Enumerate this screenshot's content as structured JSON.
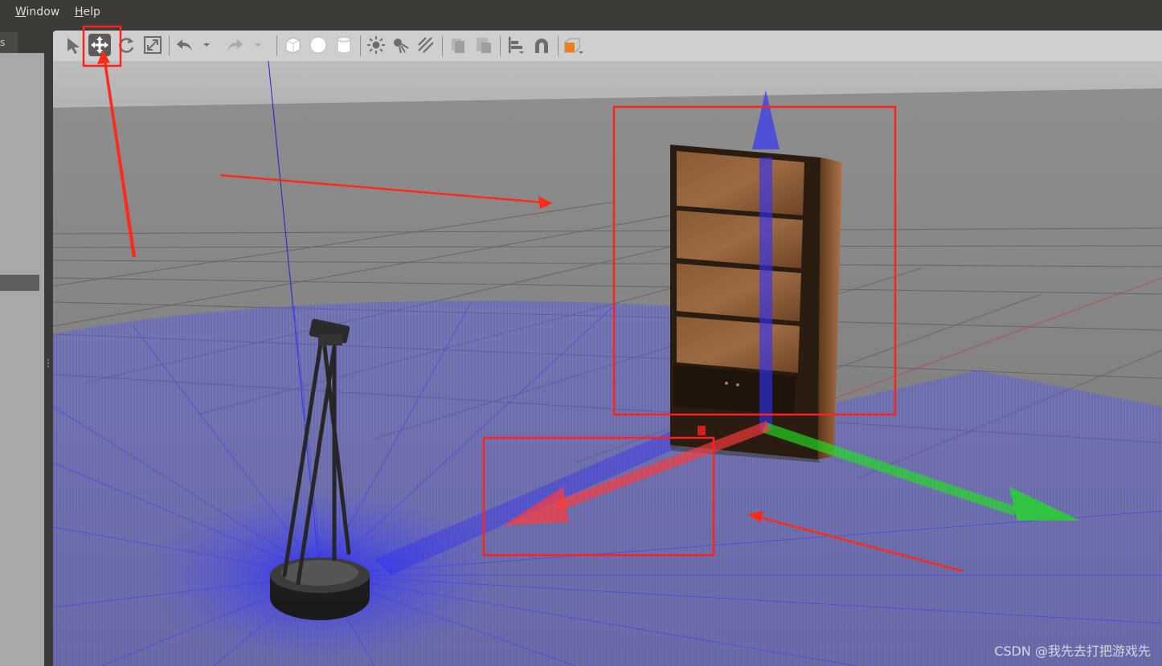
{
  "menubar": {
    "items": [
      {
        "prefix": "",
        "mnemonic": "W",
        "rest": "indow"
      },
      {
        "prefix": "",
        "mnemonic": "H",
        "rest": "elp"
      }
    ]
  },
  "left_tab": {
    "label": "s"
  },
  "toolbar": {
    "buttons": [
      {
        "name": "select-mode-icon",
        "active": false
      },
      {
        "name": "translate-mode-icon",
        "active": true
      },
      {
        "name": "rotate-mode-icon",
        "active": false
      },
      {
        "name": "scale-mode-icon",
        "active": false
      },
      {
        "name": "undo-icon",
        "active": false
      },
      {
        "name": "redo-icon",
        "active": false
      },
      {
        "name": "box-shape-icon",
        "active": false
      },
      {
        "name": "sphere-shape-icon",
        "active": false
      },
      {
        "name": "cylinder-shape-icon",
        "active": false
      },
      {
        "name": "point-light-icon",
        "active": false
      },
      {
        "name": "spot-light-icon",
        "active": false
      },
      {
        "name": "directional-light-icon",
        "active": false
      },
      {
        "name": "copy-icon",
        "active": false
      },
      {
        "name": "paste-icon",
        "active": false
      },
      {
        "name": "align-icon",
        "active": false
      },
      {
        "name": "snap-icon",
        "active": false
      },
      {
        "name": "view-angle-icon",
        "active": false
      }
    ],
    "accent_color": "#f07c1b"
  },
  "annotations": {
    "box_color": "#ff2020",
    "arrow_color": "#ff2a1a"
  },
  "scene": {
    "gizmo_colors": {
      "x": "#ff3a3a",
      "y": "#20e020",
      "z": "#3030ff"
    },
    "laser_color": "#3a3aff"
  },
  "watermark": {
    "text": "CSDN @我先去打把游戏先"
  }
}
